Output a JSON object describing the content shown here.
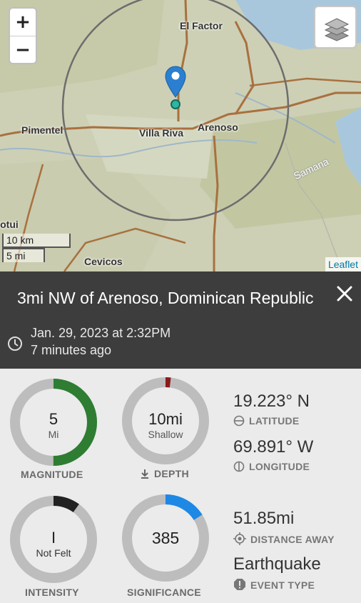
{
  "map": {
    "zoom_in": "+",
    "zoom_out": "−",
    "layers_icon": "layers-icon",
    "place_labels": [
      "El Factor",
      "Pimentel",
      "Villa Riva",
      "Arenoso",
      "Samana",
      "Cotui",
      "Cevicos"
    ],
    "scale_km": "10 km",
    "scale_mi": "5 mi",
    "attribution": "Leaflet"
  },
  "event": {
    "title": "3mi NW of Arenoso, Dominican Republic",
    "date": "Jan. 29, 2023 at 2:32PM",
    "ago": "7 minutes ago"
  },
  "metrics": {
    "magnitude": {
      "value": "5",
      "unit": "Mi",
      "label": "MAGNITUDE",
      "fraction": 0.5,
      "color": "#2e7d32"
    },
    "depth": {
      "value": "10mi",
      "unit": "Shallow",
      "label": "DEPTH",
      "fraction": 0.02,
      "color": "#8b1a1a"
    },
    "intensity": {
      "value": "I",
      "unit": "Not Felt",
      "label": "INTENSITY",
      "fraction": 0.1,
      "color": "#222222"
    },
    "significance": {
      "value": "385",
      "label": "SIGNIFICANCE",
      "fraction": 0.16,
      "color": "#1e88e5"
    },
    "latitude": {
      "value": "19.223° N",
      "label": "LATITUDE"
    },
    "longitude": {
      "value": "69.891° W",
      "label": "LONGITUDE"
    },
    "distance": {
      "value": "51.85mi",
      "label": "DISTANCE AWAY"
    },
    "event_type": {
      "value": "Earthquake",
      "label": "EVENT TYPE"
    }
  }
}
